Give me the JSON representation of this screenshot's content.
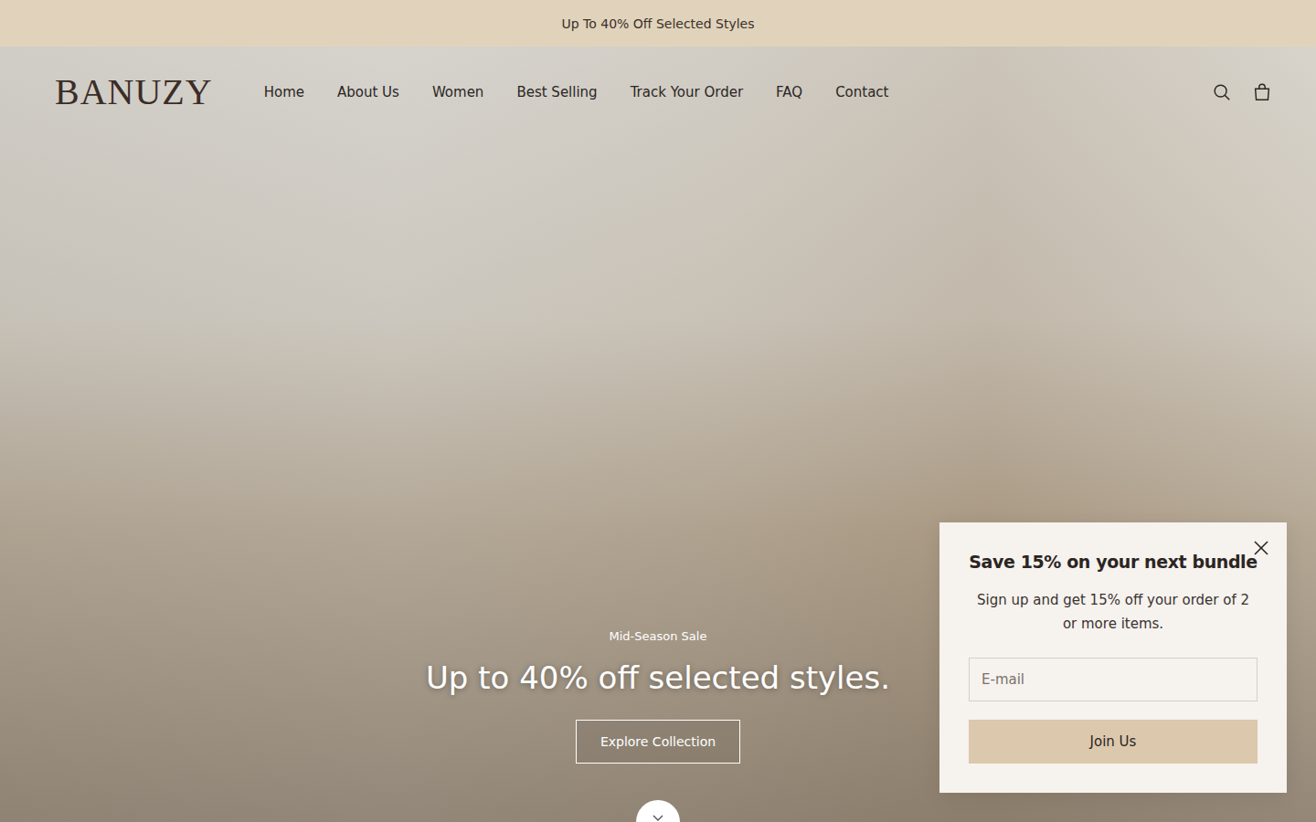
{
  "announcement": "Up To 40% Off Selected Styles",
  "header": {
    "logo": "BANUZY",
    "nav": [
      "Home",
      "About Us",
      "Women",
      "Best Selling",
      "Track Your Order",
      "FAQ",
      "Contact"
    ]
  },
  "hero": {
    "eyebrow": "Mid-Season Sale",
    "title": "Up to 40% off selected styles.",
    "button": "Explore Collection"
  },
  "popup": {
    "title": "Save 15% on your next bundle",
    "text": "Sign up and get 15% off your order of 2 or more items.",
    "email_placeholder": "E-mail",
    "button": "Join Us"
  }
}
